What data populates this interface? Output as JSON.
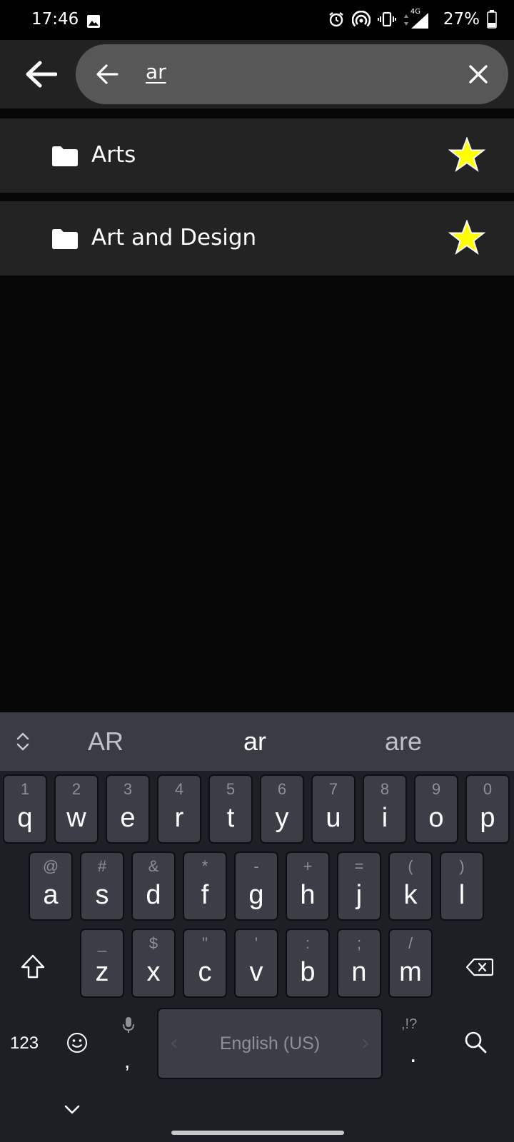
{
  "status_bar": {
    "time": "17:46",
    "network": "4G",
    "battery_percent": "27%"
  },
  "search": {
    "query": "ar"
  },
  "results": [
    {
      "label": "Arts",
      "starred": true
    },
    {
      "label": "Art and Design",
      "starred": true
    }
  ],
  "keyboard": {
    "suggestions": [
      "AR",
      "ar",
      "are"
    ],
    "row1": [
      {
        "hint": "1",
        "key": "q"
      },
      {
        "hint": "2",
        "key": "w"
      },
      {
        "hint": "3",
        "key": "e"
      },
      {
        "hint": "4",
        "key": "r"
      },
      {
        "hint": "5",
        "key": "t"
      },
      {
        "hint": "6",
        "key": "y"
      },
      {
        "hint": "7",
        "key": "u"
      },
      {
        "hint": "8",
        "key": "i"
      },
      {
        "hint": "9",
        "key": "o"
      },
      {
        "hint": "0",
        "key": "p"
      }
    ],
    "row2": [
      {
        "hint": "@",
        "key": "a"
      },
      {
        "hint": "#",
        "key": "s"
      },
      {
        "hint": "&",
        "key": "d"
      },
      {
        "hint": "*",
        "key": "f"
      },
      {
        "hint": "-",
        "key": "g"
      },
      {
        "hint": "+",
        "key": "h"
      },
      {
        "hint": "=",
        "key": "j"
      },
      {
        "hint": "(",
        "key": "k"
      },
      {
        "hint": ")",
        "key": "l"
      }
    ],
    "row3": [
      {
        "hint": "_",
        "key": "z"
      },
      {
        "hint": "$",
        "key": "x"
      },
      {
        "hint": "\"",
        "key": "c"
      },
      {
        "hint": "'",
        "key": "v"
      },
      {
        "hint": ":",
        "key": "b"
      },
      {
        "hint": ";",
        "key": "n"
      },
      {
        "hint": "/",
        "key": "m"
      }
    ],
    "numbers_label": "123",
    "comma": ",",
    "space_label": "English (US)",
    "period_hint": ",!?",
    "period": "."
  },
  "colors": {
    "accent_star": "#ffff00",
    "app_bar": "#222222",
    "search_pill": "#575757"
  }
}
